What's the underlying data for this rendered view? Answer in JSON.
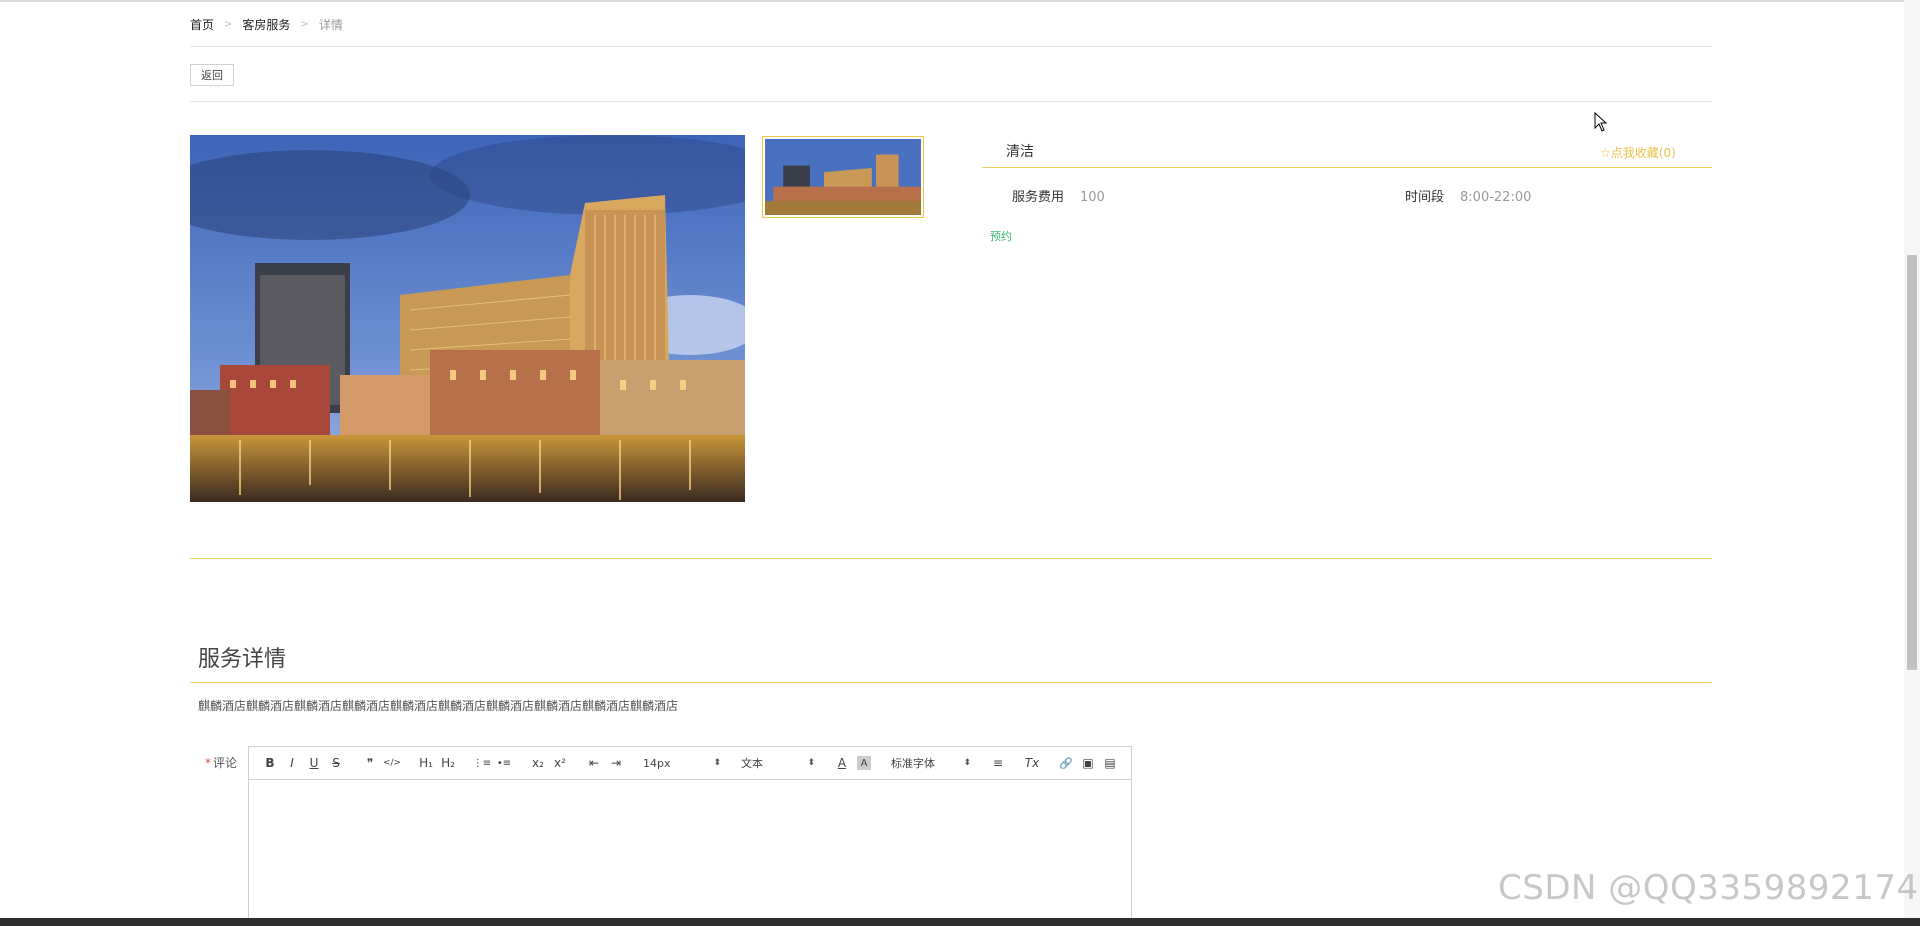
{
  "breadcrumb": {
    "home": "首页",
    "section": "客房服务",
    "current": "详情",
    "separator": ">"
  },
  "back_label": "返回",
  "service": {
    "name": "清洁",
    "favorite_label": "☆点我收藏(0)",
    "fee_label": "服务费用",
    "fee_value": "100",
    "time_label": "时间段",
    "time_value": "8:00-22:00",
    "book_label": "预约"
  },
  "details": {
    "title": "服务详情",
    "description": "麒麟酒店麒麟酒店麒麟酒店麒麟酒店麒麟酒店麒麟酒店麒麟酒店麒麟酒店麒麟酒店麒麟酒店"
  },
  "comment": {
    "required_mark": "*",
    "label": "评论"
  },
  "editor_toolbar": {
    "bold": "B",
    "italic": "I",
    "underline": "U",
    "strike": "S",
    "quote": "❞",
    "code": "</>",
    "h1": "H₁",
    "h2": "H₂",
    "ordered_list": "⋮≡",
    "bullet_list": "•≡",
    "subscript": "x₂",
    "superscript": "x²",
    "outdent": "⇤",
    "indent": "⇥",
    "size_value": "14px",
    "paragraph_value": "文本",
    "color": "A",
    "background": "A",
    "font_value": "标准字体",
    "align": "≡",
    "clean": "Tx",
    "link": "🔗",
    "image": "▣",
    "video": "▤"
  },
  "watermark": "CSDN @QQ3359892174",
  "colors": {
    "accent_yellow": "#f0d060",
    "favorite_color": "#e8c24a",
    "book_green": "#3cb371"
  }
}
